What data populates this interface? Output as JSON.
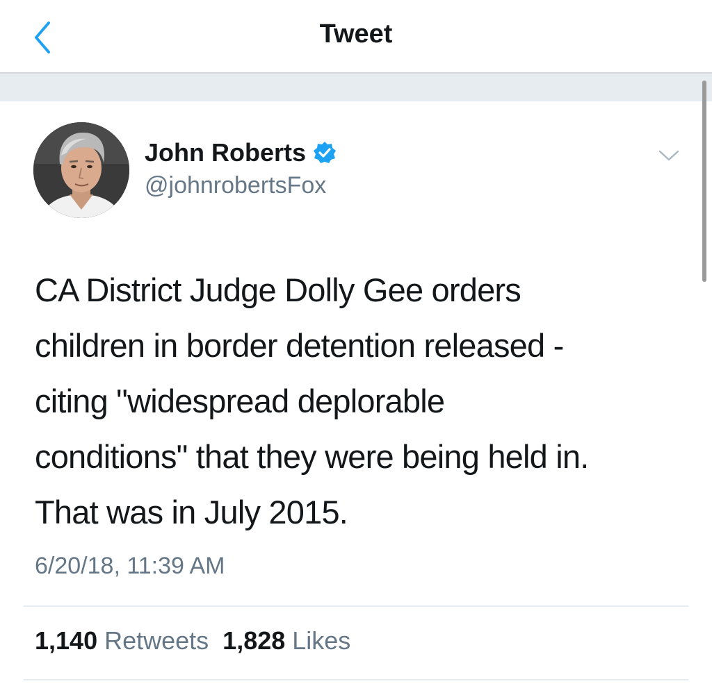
{
  "header": {
    "title": "Tweet",
    "back_icon": "chevron-left-icon"
  },
  "colors": {
    "accent": "#1da1f2",
    "text_primary": "#14171a",
    "text_secondary": "#657786",
    "divider": "#e6ecf0"
  },
  "tweet": {
    "author": {
      "display_name": "John Roberts",
      "handle": "@johnrobertsFox",
      "verified": true
    },
    "text_lines": [
      "CA District Judge Dolly Gee orders",
      "children in border detention released -",
      "citing \"widespread deplorable",
      "conditions\" that they were being held in.",
      "That was in July 2015."
    ],
    "timestamp": "6/20/18, 11:39 AM",
    "stats": {
      "retweets_count": "1,140",
      "retweets_label": "Retweets",
      "likes_count": "1,828",
      "likes_label": "Likes"
    }
  }
}
